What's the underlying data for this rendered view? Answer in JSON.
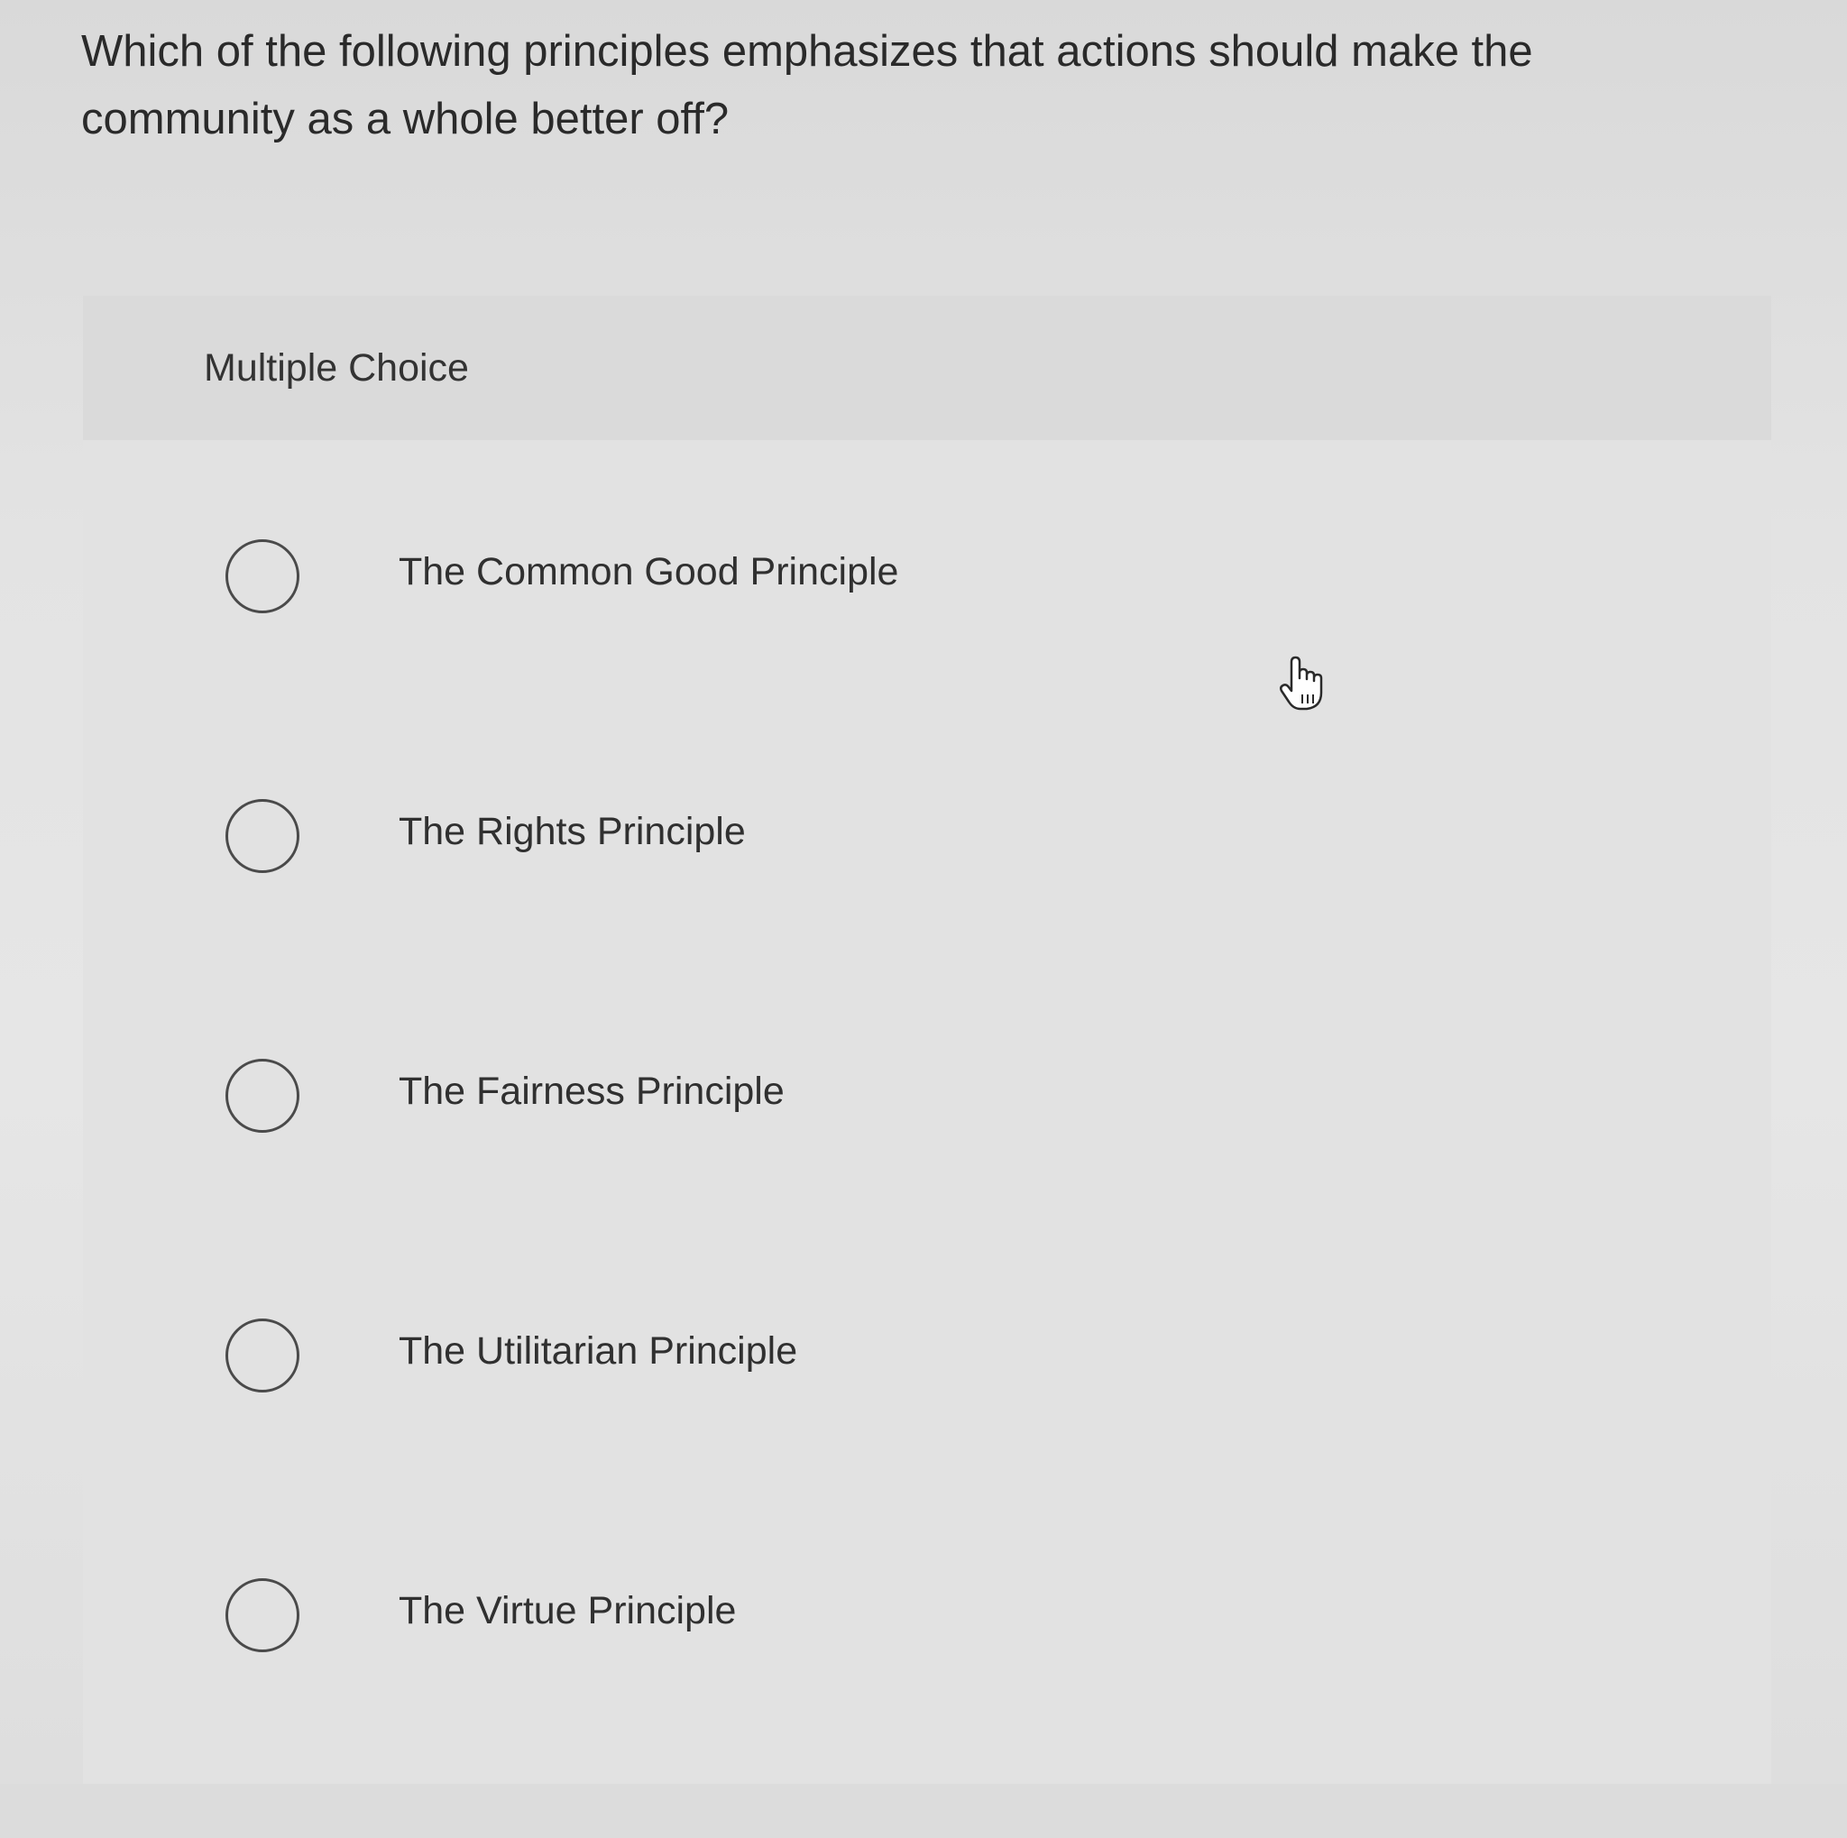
{
  "question": {
    "line1": "Which of the following principles emphasizes that actions should make the",
    "line2": "community as a whole better off?"
  },
  "section_label": "Multiple Choice",
  "options": [
    {
      "label": "The Common Good Principle",
      "selected": false
    },
    {
      "label": "The Rights Principle",
      "selected": false
    },
    {
      "label": "The Fairness Principle",
      "selected": false
    },
    {
      "label": "The Utilitarian Principle",
      "selected": false
    },
    {
      "label": "The Virtue Principle",
      "selected": false
    }
  ],
  "cursor_icon": "hand-pointer-icon"
}
